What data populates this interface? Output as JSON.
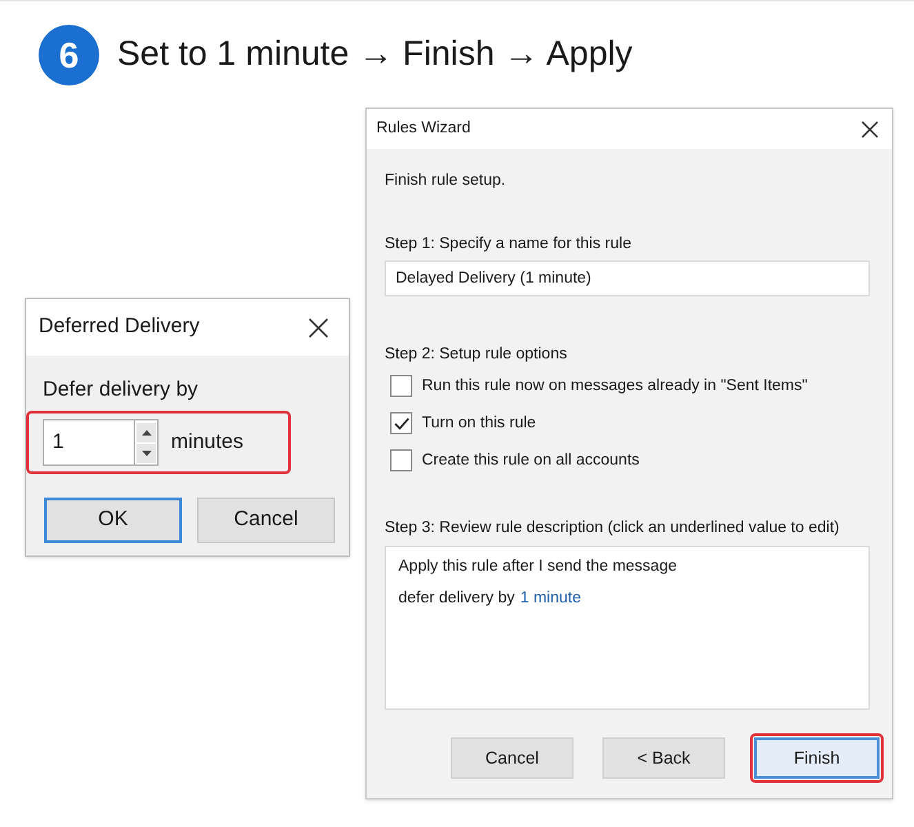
{
  "step": {
    "number": "6",
    "title": "Set to 1 minute → Finish → Apply"
  },
  "deferred_delivery": {
    "title": "Deferred Delivery",
    "label": "Defer delivery by",
    "minutes": {
      "value": "1",
      "unit": "minutes",
      "highlighted": true
    },
    "buttons": [
      {
        "label": "OK",
        "default": true
      },
      {
        "label": "Cancel",
        "default": false
      }
    ]
  },
  "rules_wizard": {
    "title": "Rules Wizard",
    "intro": "Finish rule setup.",
    "step1_label": "Step 1: Specify a name for this rule",
    "rule_name": "Delayed Delivery (1 minute)",
    "step2_label": "Step 2: Setup rule options",
    "options": [
      {
        "label": "Run this rule now on messages already in \"Sent Items\"",
        "checked": false
      },
      {
        "label": "Turn on this rule",
        "checked": true
      },
      {
        "label": "Create this rule on all accounts",
        "checked": false
      }
    ],
    "step3_label": "Step 3: Review rule description (click an underlined value to edit)",
    "description": [
      {
        "text": "Apply this rule after I send the message"
      },
      {
        "text": "defer delivery by",
        "link": "1 minute"
      }
    ],
    "buttons": [
      {
        "label": "Cancel",
        "default": false,
        "highlighted": false
      },
      {
        "label": "< Back",
        "default": false,
        "highlighted": false
      },
      {
        "label": "Finish",
        "default": true,
        "highlighted": true
      }
    ]
  }
}
